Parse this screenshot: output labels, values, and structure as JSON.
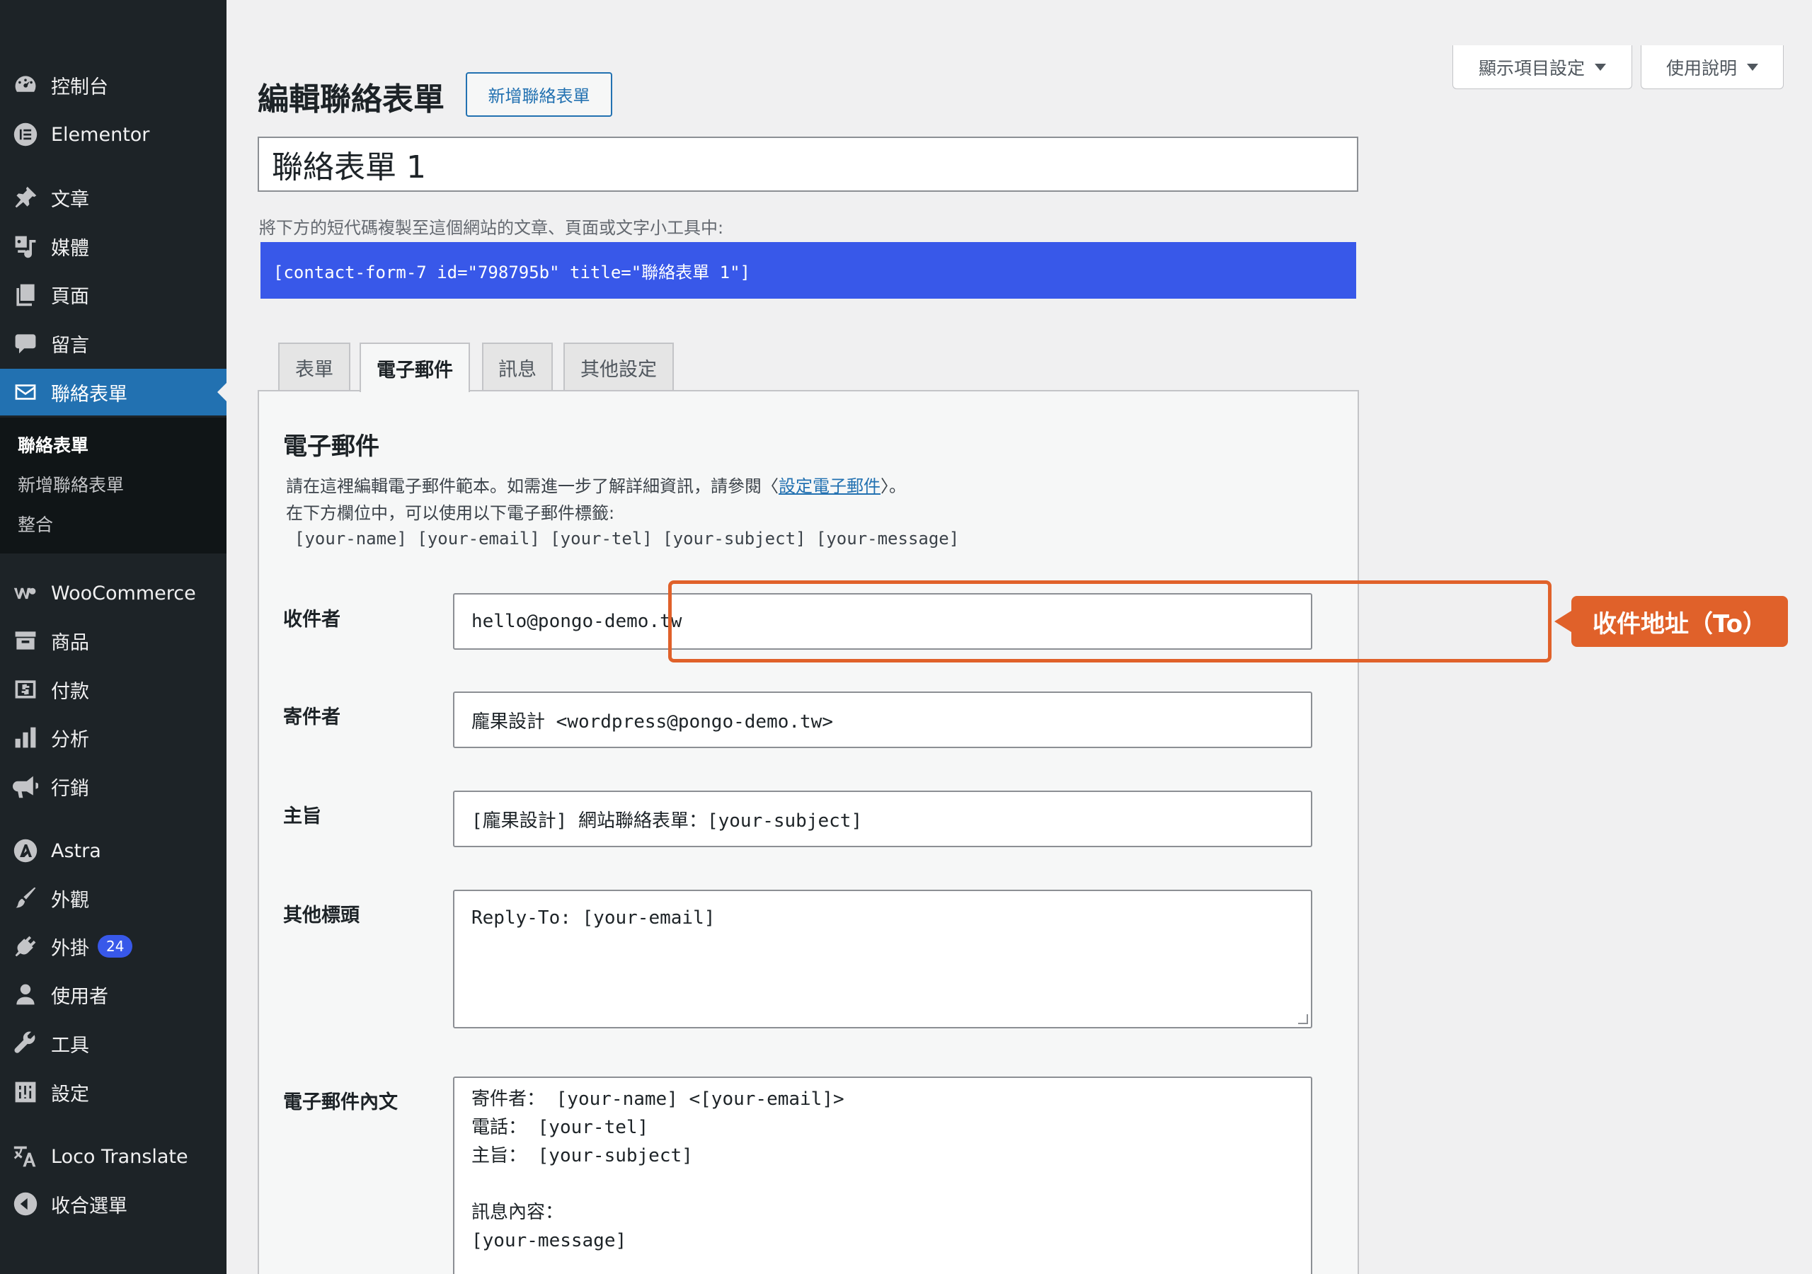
{
  "sidebar": {
    "items": [
      {
        "label": "控制台",
        "icon": "dashboard-icon"
      },
      {
        "label": "Elementor",
        "icon": "elementor-icon"
      },
      {
        "label": "文章",
        "icon": "pin-icon"
      },
      {
        "label": "媒體",
        "icon": "media-icon"
      },
      {
        "label": "頁面",
        "icon": "pages-icon"
      },
      {
        "label": "留言",
        "icon": "comment-icon"
      },
      {
        "label": "聯絡表單",
        "icon": "mail-icon"
      },
      {
        "label": "WooCommerce",
        "icon": "woocommerce-icon"
      },
      {
        "label": "商品",
        "icon": "archive-icon"
      },
      {
        "label": "付款",
        "icon": "dollar-icon"
      },
      {
        "label": "分析",
        "icon": "chart-bar-icon"
      },
      {
        "label": "行銷",
        "icon": "megaphone-icon"
      },
      {
        "label": "Astra",
        "icon": "astra-icon"
      },
      {
        "label": "外觀",
        "icon": "paintbrush-icon"
      },
      {
        "label": "外掛",
        "icon": "plugin-icon"
      },
      {
        "label": "使用者",
        "icon": "user-icon"
      },
      {
        "label": "工具",
        "icon": "wrench-icon"
      },
      {
        "label": "設定",
        "icon": "settings-icon"
      },
      {
        "label": "Loco Translate",
        "icon": "translate-icon"
      },
      {
        "label": "收合選單",
        "icon": "collapse-icon"
      }
    ],
    "plugins_badge": "24",
    "submenu": [
      "聯絡表單",
      "新增聯絡表單",
      "整合"
    ]
  },
  "screen_options": {
    "label": "顯示項目設定",
    "help_label": "使用說明"
  },
  "header": {
    "title": "編輯聯絡表單",
    "add_new": "新增聯絡表單"
  },
  "form_title": "聯絡表單 1",
  "shortcode": {
    "hint": "將下方的短代碼複製至這個網站的文章、頁面或文字小工具中:",
    "code": "[contact-form-7 id=\"798795b\" title=\"聯絡表單 1\"]"
  },
  "tabs": [
    "表單",
    "電子郵件",
    "訊息",
    "其他設定"
  ],
  "mail": {
    "heading": "電子郵件",
    "desc_line1_before": "請在這裡編輯電子郵件範本。如需進一步了解詳細資訊，請參閱〈",
    "desc_link": "設定電子郵件",
    "desc_line1_after": "〉。",
    "desc_line2": "在下方欄位中，可以使用以下電子郵件標籤:",
    "tags": "[your-name] [your-email] [your-tel] [your-subject] [your-message]",
    "to_label": "收件者",
    "to_value": "hello@pongo-demo.tw",
    "from_label": "寄件者",
    "from_value": "龐果設計 <wordpress@pongo-demo.tw>",
    "subject_label": "主旨",
    "subject_value": "[龐果設計] 網站聯絡表單：[your-subject]",
    "headers_label": "其他標頭",
    "headers_value": "Reply-To: [your-email]",
    "body_label": "電子郵件內文",
    "body_value": "寄件者： [your-name] <[your-email]>\n電話： [your-tel]\n主旨： [your-subject]\n\n訊息內容：\n[your-message]"
  },
  "annotation": {
    "callout": "收件地址（To）",
    "color": "#e0612a"
  },
  "colors": {
    "sidebar": "#1d2327",
    "active": "#2271b1",
    "shortcode_bg": "#3858e9"
  }
}
